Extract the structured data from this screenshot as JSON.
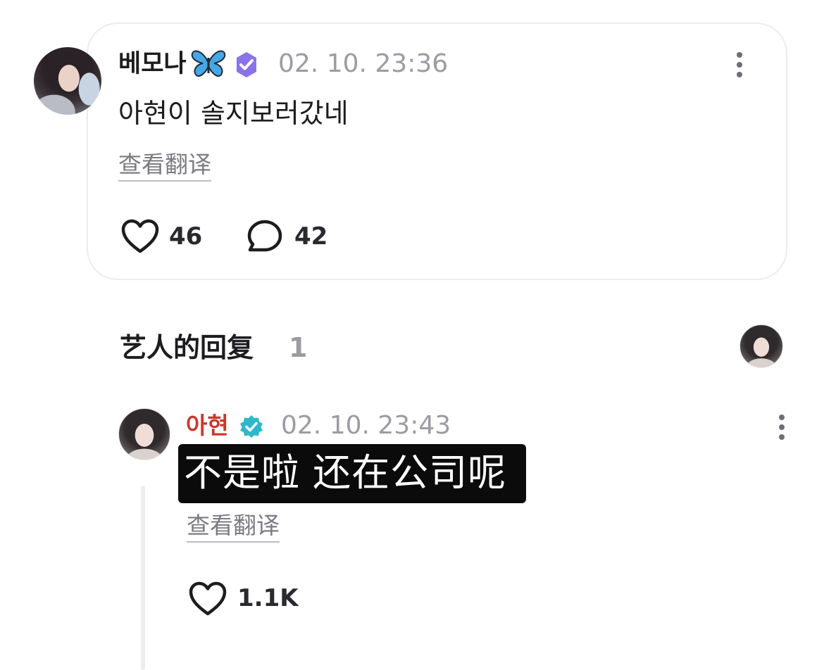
{
  "post": {
    "username": "베모나",
    "timestamp": "02. 10. 23:36",
    "text": "아현이 솔지보러갔네",
    "translate_label": "查看翻译",
    "likes": "46",
    "comments": "42"
  },
  "artist_replies": {
    "title": "艺人的回复",
    "count": "1"
  },
  "reply": {
    "username": "아현",
    "timestamp": "02. 10. 23:43",
    "text": "不是啦 还在公司呢",
    "translate_label": "查看翻译",
    "likes": "1.1K"
  },
  "colors": {
    "reply_username": "#c8382f",
    "verified_badge_post": "#8a73e6",
    "verified_badge_reply": "#2fb8c9",
    "muted_text": "#9b9ba1",
    "card_border": "#ececef"
  },
  "icons": {
    "butterfly": "butterfly-emoji",
    "verified_post": "verified-badge-icon",
    "verified_reply": "verified-badge-icon",
    "more": "more-vertical-icon",
    "like": "heart-icon",
    "comment": "comment-bubble-icon"
  }
}
